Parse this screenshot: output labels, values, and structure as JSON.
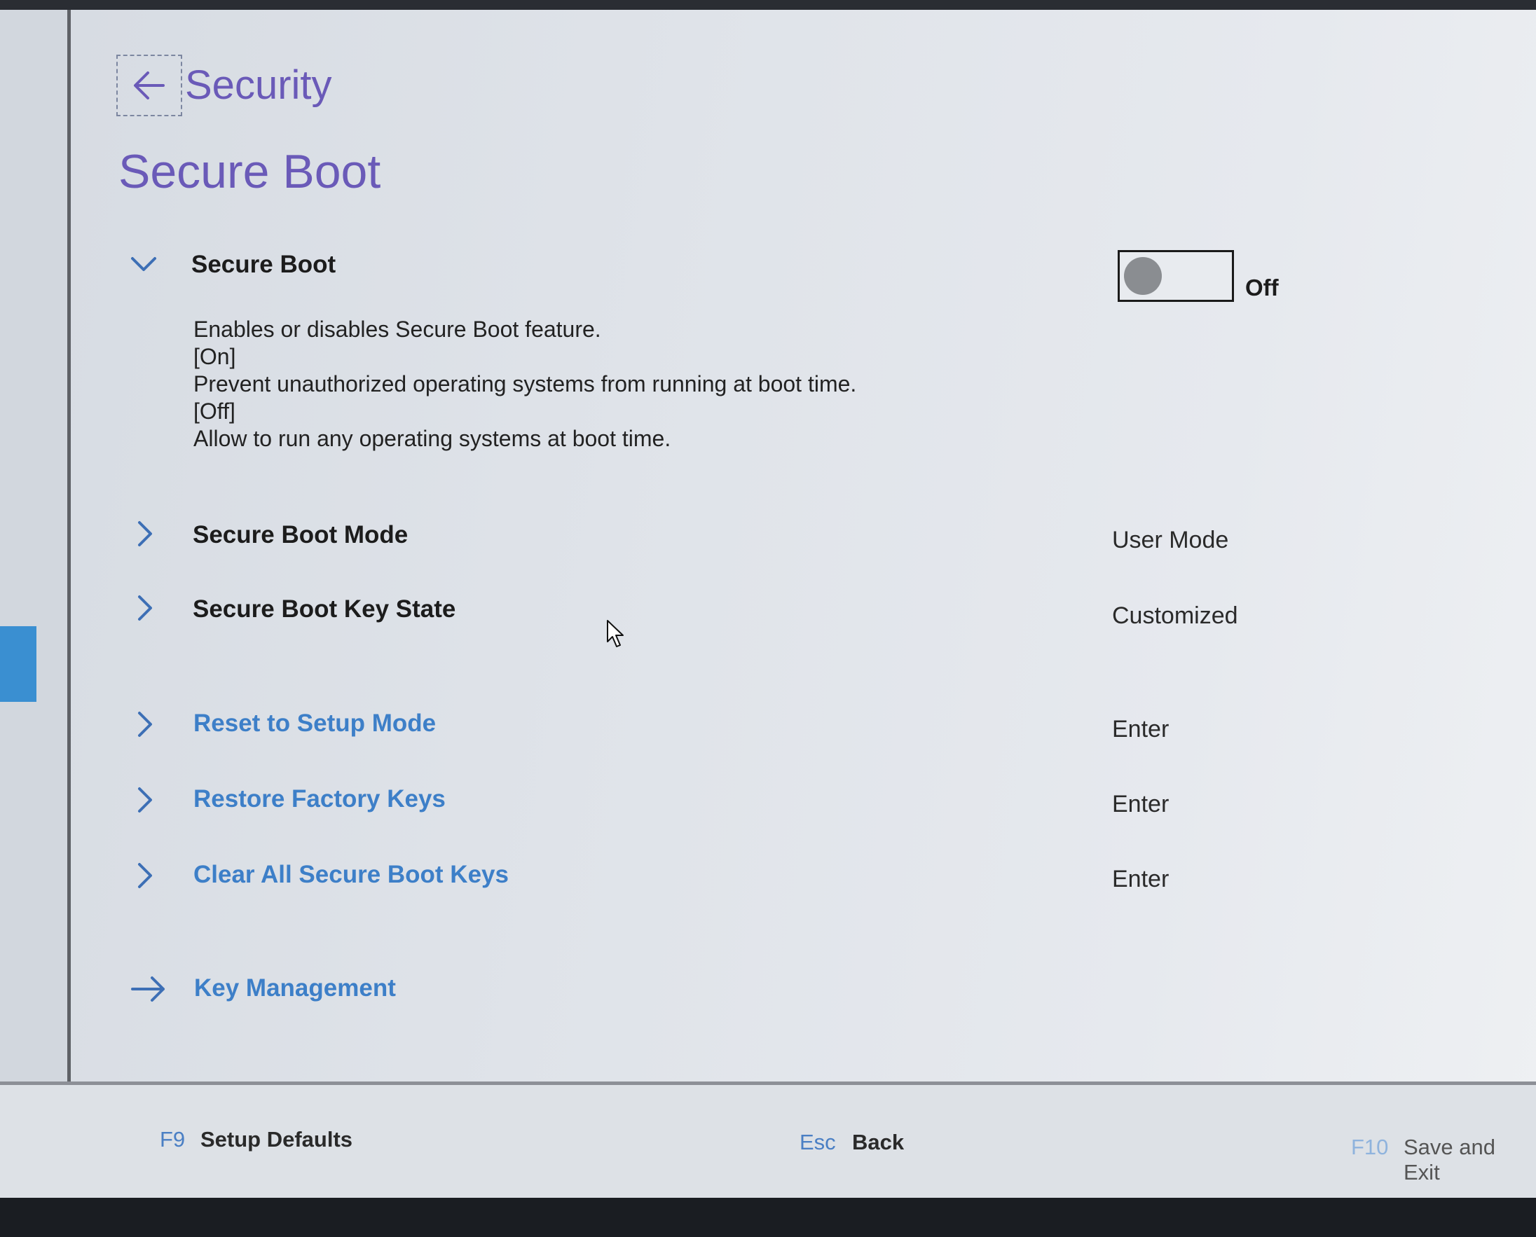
{
  "breadcrumb": {
    "back_label": "Security"
  },
  "page_title": "Secure Boot",
  "secure_boot": {
    "label": "Secure Boot",
    "toggle_state": "Off",
    "description": [
      "Enables or disables Secure Boot feature.",
      "[On]",
      "Prevent unauthorized operating systems from running at boot time.",
      "[Off]",
      "Allow to run any  operating systems at boot time."
    ]
  },
  "rows": [
    {
      "label": "Secure Boot Mode",
      "value": "User Mode"
    },
    {
      "label": "Secure Boot Key State",
      "value": "Customized"
    },
    {
      "label": "Reset to Setup Mode",
      "value": "Enter"
    },
    {
      "label": "Restore Factory Keys",
      "value": "Enter"
    },
    {
      "label": "Clear All Secure Boot Keys",
      "value": "Enter"
    }
  ],
  "key_management": {
    "label": "Key Management"
  },
  "footer": {
    "f9_key": "F9",
    "f9_label": "Setup Defaults",
    "esc_key": "Esc",
    "esc_label": "Back",
    "f10_key": "F10",
    "f10_label": "Save and Exit"
  },
  "colors": {
    "accent_purple": "#6a5ab8",
    "link_blue": "#3d7fc8",
    "rail_marker": "#3a8fd1"
  },
  "icons": [
    "back-arrow-icon",
    "chevron-down-icon",
    "chevron-right-icon",
    "arrow-right-icon",
    "mouse-pointer-icon"
  ]
}
